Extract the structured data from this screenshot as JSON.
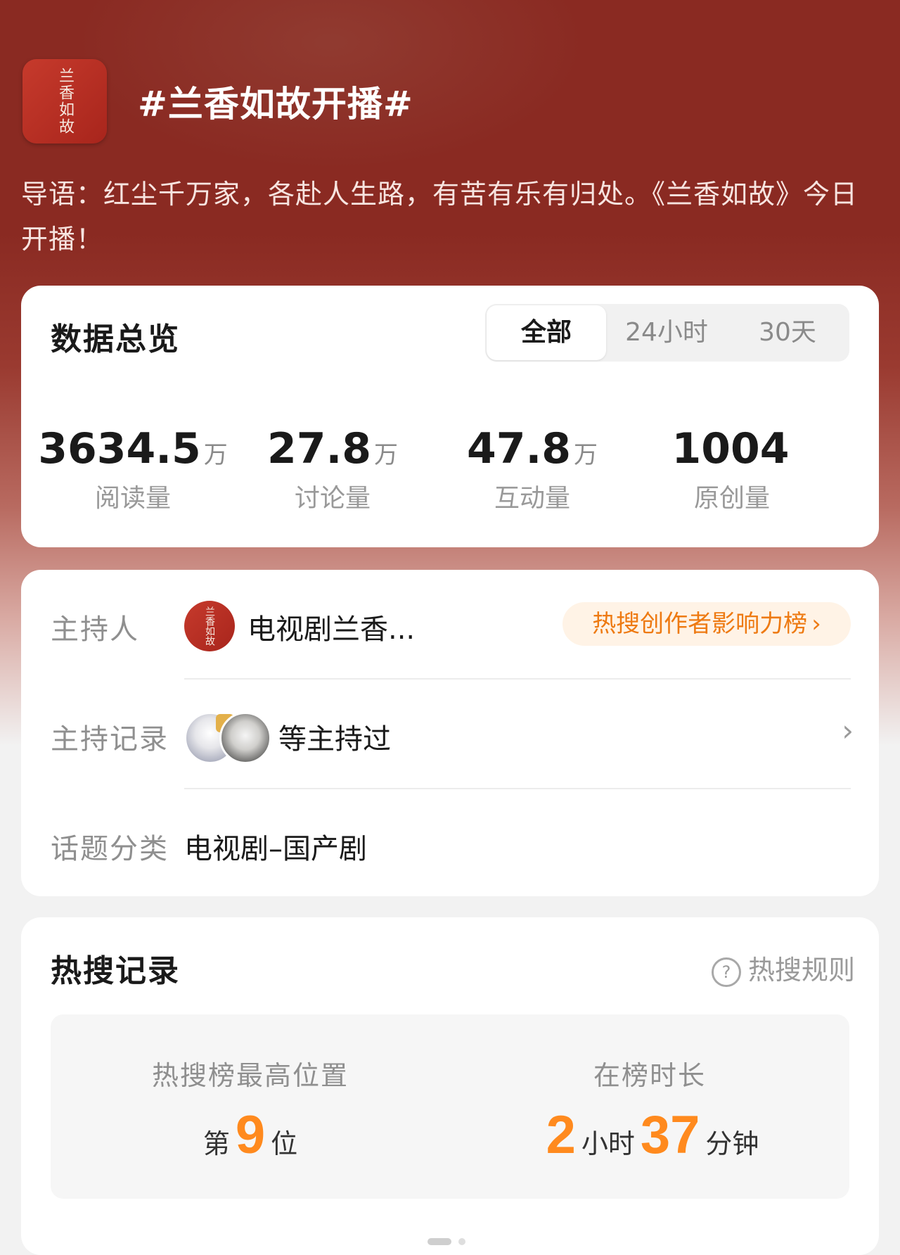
{
  "topic": {
    "icon_text": "兰香如故",
    "title": "#兰香如故开播#",
    "intro": "导语：红尘千万家，各赴人生路，有苦有乐有归处。《兰香如故》今日开播！"
  },
  "overview": {
    "title": "数据总览",
    "tabs": [
      {
        "label": "全部",
        "active": true
      },
      {
        "label": "24小时",
        "active": false
      },
      {
        "label": "30天",
        "active": false
      }
    ],
    "stats": [
      {
        "value": "3634.5",
        "unit": "万",
        "label": "阅读量"
      },
      {
        "value": "27.8",
        "unit": "万",
        "label": "讨论量"
      },
      {
        "value": "47.8",
        "unit": "万",
        "label": "互动量"
      },
      {
        "value": "1004",
        "unit": "",
        "label": "原创量"
      }
    ]
  },
  "info": {
    "host_label": "主持人",
    "host_avatar_text": "兰香如故",
    "host_name": "电视剧兰香...",
    "rank_chip": "热搜创作者影响力榜",
    "record_label": "主持记录",
    "record_text": "等主持过",
    "category_label": "话题分类",
    "category_value": "电视剧–国产剧"
  },
  "hot": {
    "title": "热搜记录",
    "rules_label": "热搜规则",
    "peak_title": "热搜榜最高位置",
    "peak_prefix": "第",
    "peak_value": "9",
    "peak_suffix": "位",
    "duration_title": "在榜时长",
    "duration_hours": "2",
    "duration_hours_unit": "小时",
    "duration_minutes": "37",
    "duration_minutes_unit": "分钟"
  },
  "colors": {
    "hero": "#8a2a22",
    "accent_orange": "#ff8a1e",
    "chip_text": "#ee7a12",
    "chip_bg": "#fff3e6"
  },
  "icons": [
    "seal-logo-icon",
    "chevron-right-icon",
    "help-circle-icon"
  ]
}
